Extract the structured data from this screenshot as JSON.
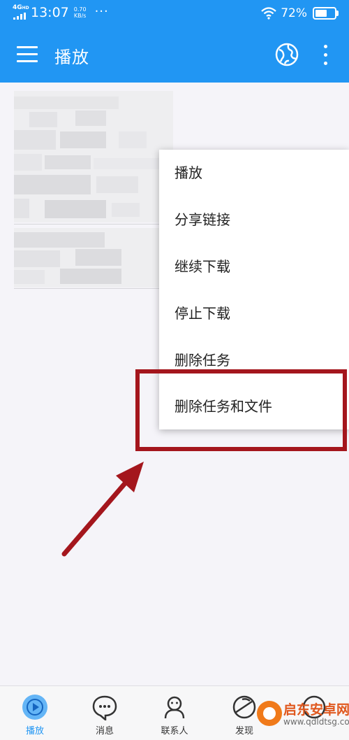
{
  "status_bar": {
    "network": "4G",
    "network_sub": "HD",
    "time": "13:07",
    "speed_value": "0.70",
    "speed_unit": "KB/s",
    "more": "···",
    "wifi_icon": "wifi-icon",
    "battery_percent": "72%",
    "battery_level": 0.72
  },
  "app_bar": {
    "title": "播放",
    "menu_icon": "hamburger-menu-icon",
    "action_icon": "globe-icon",
    "overflow_icon": "more-vertical-icon",
    "color": "#2196f3"
  },
  "popup_menu": {
    "items": [
      {
        "label": "播放"
      },
      {
        "label": "分享链接"
      },
      {
        "label": "继续下载"
      },
      {
        "label": "停止下载"
      },
      {
        "label": "删除任务"
      },
      {
        "label": "删除任务和文件"
      }
    ]
  },
  "annotation": {
    "color": "#a4161d",
    "highlighted_item": "删除任务和文件"
  },
  "bottom_nav": {
    "tabs": [
      {
        "label": "播放",
        "icon": "play-circle-icon",
        "active": true
      },
      {
        "label": "消息",
        "icon": "chat-bubble-icon",
        "active": false
      },
      {
        "label": "联系人",
        "icon": "contacts-icon",
        "active": false
      },
      {
        "label": "发现",
        "icon": "discover-icon",
        "active": false
      },
      {
        "label": "",
        "icon": "more-tab-icon",
        "active": false
      }
    ],
    "active_color": "#2196f3"
  },
  "watermark": {
    "title": "启东安卓网",
    "url": "www.qdldtsg.com"
  }
}
